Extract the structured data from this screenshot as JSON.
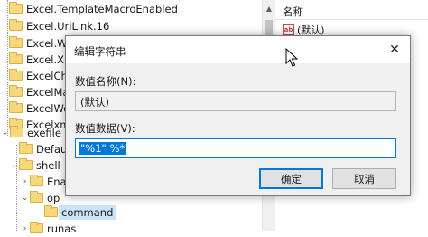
{
  "tree": {
    "items": [
      {
        "label": "Excel.TemplateMacroEnabled"
      },
      {
        "label": "Excel.UriLink.16"
      },
      {
        "label": "Excel.Wo"
      },
      {
        "label": "Excel.XLL"
      },
      {
        "label": "ExcelCha"
      },
      {
        "label": "ExcelMa"
      },
      {
        "label": "ExcelWo"
      },
      {
        "label": "Excelxml"
      },
      {
        "label": "exefile"
      },
      {
        "label": "Defau"
      },
      {
        "label": "shell"
      },
      {
        "label": "Ena"
      },
      {
        "label": "op"
      },
      {
        "label": "command"
      },
      {
        "label": "runas"
      }
    ]
  },
  "right_pane": {
    "column_name": "名称",
    "icon": "string-value-icon",
    "icon_text": "ab",
    "value_name": "(默认)"
  },
  "dialog": {
    "title": "编辑字符串",
    "value_name_label": "数值名称(N):",
    "value_name": "(默认)",
    "value_data_label": "数值数据(V):",
    "value_data": "\"%1\" %*",
    "ok_label": "确定",
    "cancel_label": "取消",
    "close_glyph": "✕"
  },
  "colors": {
    "accent": "#0078d7",
    "folder": "#f7d97b",
    "selection": "#cce4f7"
  }
}
